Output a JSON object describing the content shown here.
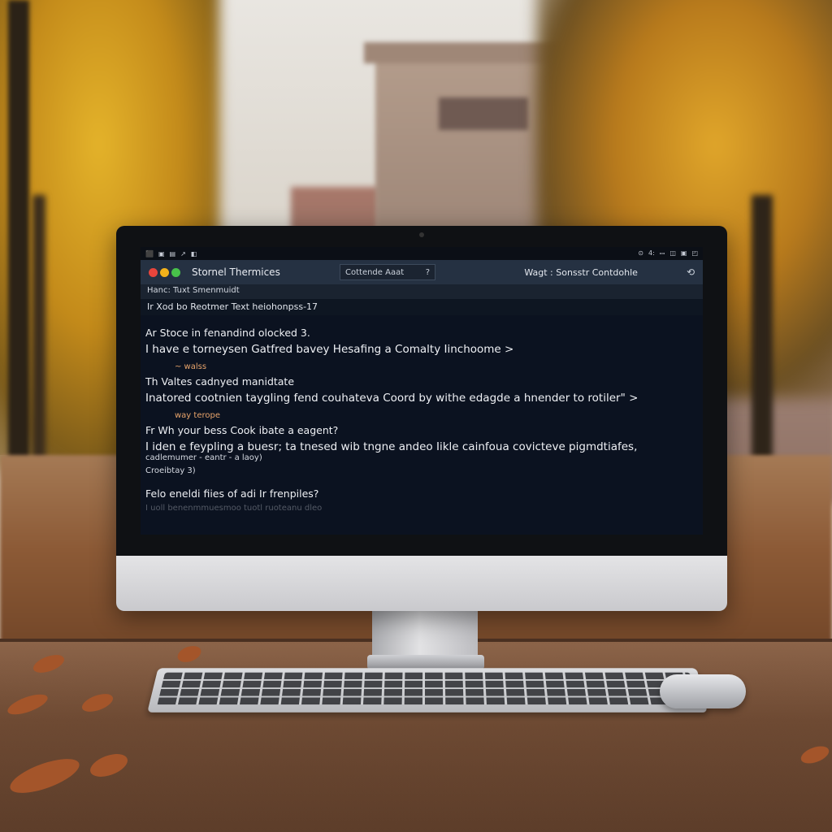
{
  "screen": {
    "status_left": [
      "⬛",
      "▣",
      "▤",
      "↗",
      "◧"
    ],
    "status_right": [
      "⊙",
      "4:",
      "ꟷ",
      "◫",
      "▣",
      "◰"
    ],
    "traffic_colors": [
      "#e8453c",
      "#f3b21b",
      "#48c24a"
    ],
    "app_title": "Stornel Thermices",
    "search_label": "Cottende Aaat",
    "search_icon": "?",
    "right_label": "Wagt : Sonsstr Contdohle",
    "right_icon_char": "⟲",
    "subbar_text": "Hanc:   Tuxt Smenmuidt",
    "path_text": "Ir Xod bo Reotmer Text heiohonpss-17",
    "lines": [
      {
        "text": "Ar Stoce in fenandind olocked 3.",
        "kind": "head"
      },
      {
        "text": "I have e torneysen Gatfred bavey Hesafing a Comalty Iinchoome  >",
        "kind": "body"
      },
      {
        "text": "~ walss",
        "kind": "meta"
      },
      {
        "text": "Th Valtes cadnyed manidtate",
        "kind": "head"
      },
      {
        "text": "Inatored cootnien taygling fend couhateva Coord by withe edagde a hnender to rotiler\" >",
        "kind": "body"
      },
      {
        "text": "way terope",
        "kind": "meta"
      },
      {
        "text": "Fr Wh your bess Cook ibate a eagent?",
        "kind": "head"
      },
      {
        "text": "I iden e feypling a buesr; ta tnesed wib tngne andeo Iikle cainfoua covicteve pigmdtiafes,",
        "kind": "body"
      },
      {
        "text": "cadlemumer - eantr - a laoy)",
        "kind": "small"
      },
      {
        "text": "Croeibtay 3)",
        "kind": "small"
      },
      {
        "text": "Felo eneldi fiies of adi Ir frenpiles?",
        "kind": "head"
      },
      {
        "text": "I uoll benenmmuesmoo tuotl ruoteanu dleo",
        "kind": "small"
      }
    ]
  }
}
